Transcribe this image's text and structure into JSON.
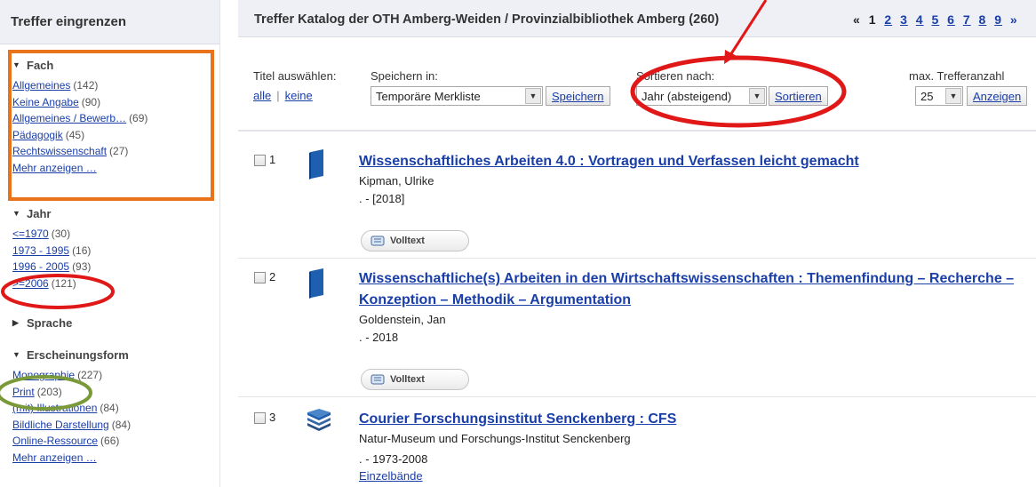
{
  "sidebar": {
    "title": "Treffer eingrenzen",
    "facets": [
      {
        "title": "Fach",
        "expanded": true,
        "items": [
          {
            "label": "Allgemeines",
            "count": "(142)"
          },
          {
            "label": "Keine Angabe",
            "count": "(90)"
          },
          {
            "label": "Allgemeines / Bewerb…",
            "count": "(69)"
          },
          {
            "label": "Pädagogik",
            "count": "(45)"
          },
          {
            "label": "Rechtswissenschaft",
            "count": "(27)"
          },
          {
            "label": "Mehr anzeigen …",
            "count": ""
          }
        ]
      },
      {
        "title": "Jahr",
        "expanded": true,
        "items": [
          {
            "label": "<=1970",
            "count": "(30)"
          },
          {
            "label": "1973 - 1995",
            "count": "(16)"
          },
          {
            "label": "1996 - 2005",
            "count": "(93)"
          },
          {
            "label": ">=2006",
            "count": "(121)"
          }
        ]
      },
      {
        "title": "Sprache",
        "expanded": false,
        "items": []
      },
      {
        "title": "Erscheinungsform",
        "expanded": true,
        "items": [
          {
            "label": "Monographie",
            "count": "(227)"
          },
          {
            "label": "Print",
            "count": "(203)"
          },
          {
            "label": "(mit) Illustrationen",
            "count": "(84)"
          },
          {
            "label": "Bildliche Darstellung",
            "count": "(84)"
          },
          {
            "label": "Online-Ressource",
            "count": "(66)"
          },
          {
            "label": "Mehr anzeigen …",
            "count": ""
          }
        ]
      }
    ]
  },
  "header": {
    "title": "Treffer Katalog der OTH Amberg-Weiden / Provinzialbibliothek Amberg (260)",
    "pager": {
      "prev": "«",
      "current": "1",
      "pages": [
        "2",
        "3",
        "4",
        "5",
        "6",
        "7",
        "8",
        "9"
      ],
      "next": "»"
    }
  },
  "controls": {
    "select_titles_label": "Titel auswählen:",
    "select_all": "alle",
    "select_none": "keine",
    "save_in_label": "Speichern in:",
    "save_in_value": "Temporäre Merkliste",
    "save_button": "Speichern",
    "sort_label": "Sortieren nach:",
    "sort_value": "Jahr (absteigend)",
    "sort_button": "Sortieren",
    "max_label": "max. Trefferanzahl",
    "max_value": "25",
    "show_button": "Anzeigen"
  },
  "results": [
    {
      "number": "1",
      "icon": "book-icon",
      "title": "Wissenschaftliches Arbeiten 4.0 : Vortragen und Verfassen leicht gemacht",
      "author": "Kipman, Ulrike",
      "date": ". - [2018]",
      "action": "Volltext"
    },
    {
      "number": "2",
      "icon": "book-icon",
      "title": "Wissenschaftliche(s) Arbeiten in den Wirtschaftswissenschaften : Themenfindung – Recherche – Konzeption – Methodik – Argumentation",
      "author": "Goldenstein, Jan",
      "date": ". - 2018",
      "action": "Volltext"
    },
    {
      "number": "3",
      "icon": "multivolume-icon",
      "title": "Courier Forschungsinstitut Senckenberg : CFS",
      "author": "Natur-Museum und Forschungs-Institut Senckenberg",
      "date": ". - 1973-2008",
      "link": "Einzelbände"
    }
  ],
  "colors": {
    "link": "#1a3ea8",
    "annotation_orange": "#e8731a",
    "annotation_red": "#e01818",
    "annotation_green": "#7a9a3a",
    "header_bg": "#eef0f5"
  }
}
